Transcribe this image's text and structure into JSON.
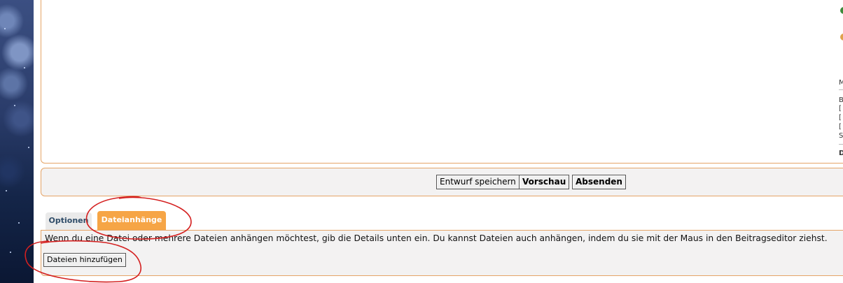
{
  "actions": {
    "save_draft": "Entwurf speichern",
    "preview": "Vorschau",
    "submit": "Absenden"
  },
  "tabs": [
    {
      "label": "Optionen",
      "active": false
    },
    {
      "label": "Dateianhänge",
      "active": true
    }
  ],
  "attachments": {
    "description": "Wenn du eine Datei oder mehrere Dateien anhängen möchtest, gib die Details unten ein. Du kannst Dateien auch anhängen, indem du sie mit der Maus in den Beitragseditor ziehst.",
    "add_button": "Dateien hinzufügen"
  },
  "right_sidebar_cut": {
    "chars": [
      "M",
      "B",
      "[",
      "[",
      "[",
      "S",
      "D"
    ]
  },
  "colors": {
    "panel_border": "#e5a467",
    "active_tab": "#f6a546",
    "inactive_tab_text": "#2f4c68",
    "annotation_red": "#d42020"
  }
}
